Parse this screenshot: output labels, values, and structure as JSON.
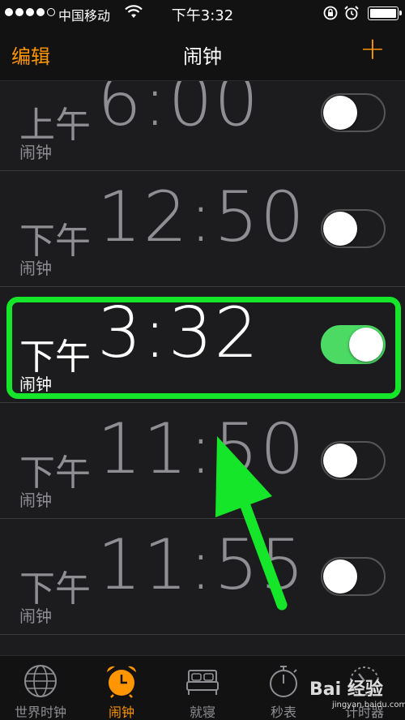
{
  "status_bar": {
    "carrier": "中国移动",
    "time": "下午3:32"
  },
  "nav": {
    "edit_label": "编辑",
    "title": "闹钟",
    "add_label": "+"
  },
  "alarms": [
    {
      "ampm": "上午",
      "time": "6:00",
      "label": "闹钟",
      "enabled": false
    },
    {
      "ampm": "下午",
      "time": "12:50",
      "label": "闹钟",
      "enabled": false
    },
    {
      "ampm": "下午",
      "time": "3:32",
      "label": "闹钟",
      "enabled": true
    },
    {
      "ampm": "下午",
      "time": "11:50",
      "label": "闹钟",
      "enabled": false
    },
    {
      "ampm": "下午",
      "time": "11:55",
      "label": "闹钟",
      "enabled": false
    }
  ],
  "tabs": [
    {
      "label": "世界时钟",
      "icon": "globe-icon",
      "active": false
    },
    {
      "label": "闹钟",
      "icon": "alarm-clock-icon",
      "active": true
    },
    {
      "label": "就寝",
      "icon": "bed-icon",
      "active": false
    },
    {
      "label": "秒表",
      "icon": "stopwatch-icon",
      "active": false
    },
    {
      "label": "计时器",
      "icon": "timer-icon",
      "active": false
    }
  ],
  "watermark": {
    "brand": "Bai 经验",
    "url": "jingyan.baidu.com"
  },
  "colors": {
    "accent": "#ff9500",
    "toggle_on": "#4cd964",
    "annotation": "#16e62a"
  }
}
